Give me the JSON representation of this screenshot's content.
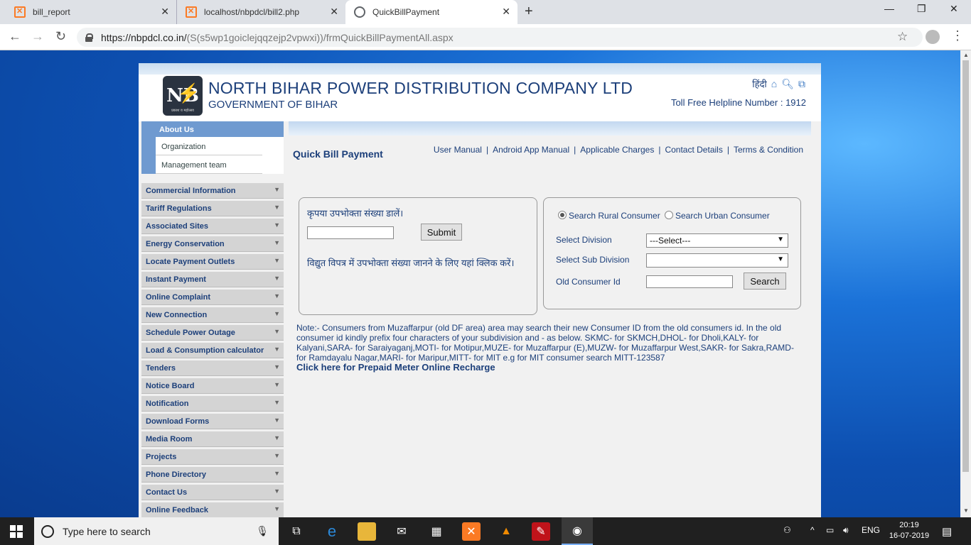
{
  "browser": {
    "tabs": [
      {
        "title": "bill_report",
        "icon": "xampp-icon"
      },
      {
        "title": "localhost/nbpdcl/bill2.php",
        "icon": "xampp-icon"
      },
      {
        "title": "QuickBillPayment",
        "icon": "globe-icon",
        "active": true
      }
    ],
    "url_host": "https://nbpdcl.co.in/",
    "url_path": "(S(s5wp1goiclejqqzejp2vpwxi))/frmQuickBillPaymentAll.aspx"
  },
  "site": {
    "logo_text": "NB",
    "logo_tagline": "प्रकाश व महोत्सव",
    "company_name": "NORTH BIHAR POWER DISTRIBUTION COMPANY LTD",
    "government": "GOVERNMENT OF BIHAR",
    "hindi_link": "हिंदी",
    "helpline": "Toll Free Helpline Number : 1912"
  },
  "sidebar": {
    "about": {
      "label": "About Us",
      "subitems": [
        "Organization",
        "Management team"
      ]
    },
    "items": [
      "Commercial Information",
      "Tariff Regulations",
      "Associated Sites",
      "Energy Conservation",
      "Locate Payment Outlets",
      "Instant Payment",
      "Online Complaint",
      "New Connection",
      "Schedule Power Outage",
      "Load & Consumption calculator",
      "Tenders",
      "Notice Board",
      "Notification",
      "Download Forms",
      "Media Room",
      "Projects",
      "Phone Directory",
      "Contact Us",
      "Online Feedback"
    ]
  },
  "main": {
    "title": "Quick Bill Payment",
    "links": [
      "User Manual",
      "Android App Manual",
      "Applicable Charges",
      "Contact Details",
      "Terms & Condition"
    ],
    "consumer_box": {
      "prompt": "कृपया उपभोक्ता संख्या डालें।",
      "consumer_value": "",
      "submit_label": "Submit",
      "help_link": "विद्युत विपत्र में उपभोक्ता संख्या जानने के लिए यहां क्लिक करें।"
    },
    "search_box": {
      "rural_label": "Search Rural Consumer",
      "urban_label": "Search Urban Consumer",
      "selected": "rural",
      "division_label": "Select Division",
      "division_value": "---Select---",
      "subdivision_label": "Select Sub Division",
      "subdivision_value": "",
      "old_id_label": "Old Consumer Id",
      "old_id_value": "",
      "search_label": "Search"
    },
    "note": "Note:- Consumers from Muzaffarpur (old DF area) area may search their new Consumer ID from the old consumers id. In the old consumer id kindly prefix four characters of your subdivision and - as below. SKMC- for SKMCH,DHOL- for Dholi,KALY- for Kalyani,SARA- for Saraiyaganj,MOTI- for Motipur,MUZE- for Muzaffarpur (E),MUZW- for Muzaffarpur West,SAKR- for Sakra,RAMD- for Ramdayalu Nagar,MARI- for Maripur,MITT- for MIT e.g for MIT consumer search MITT-123587",
    "prepaid_link": "Click here for Prepaid Meter Online Recharge"
  },
  "taskbar": {
    "search_placeholder": "Type here to search",
    "language": "ENG",
    "time": "20:19",
    "date": "16-07-2019"
  },
  "colors": {
    "brand_blue": "#1c3f7a",
    "menu_head": "#6f9ad0",
    "menu_item": "#d4d4d4"
  }
}
